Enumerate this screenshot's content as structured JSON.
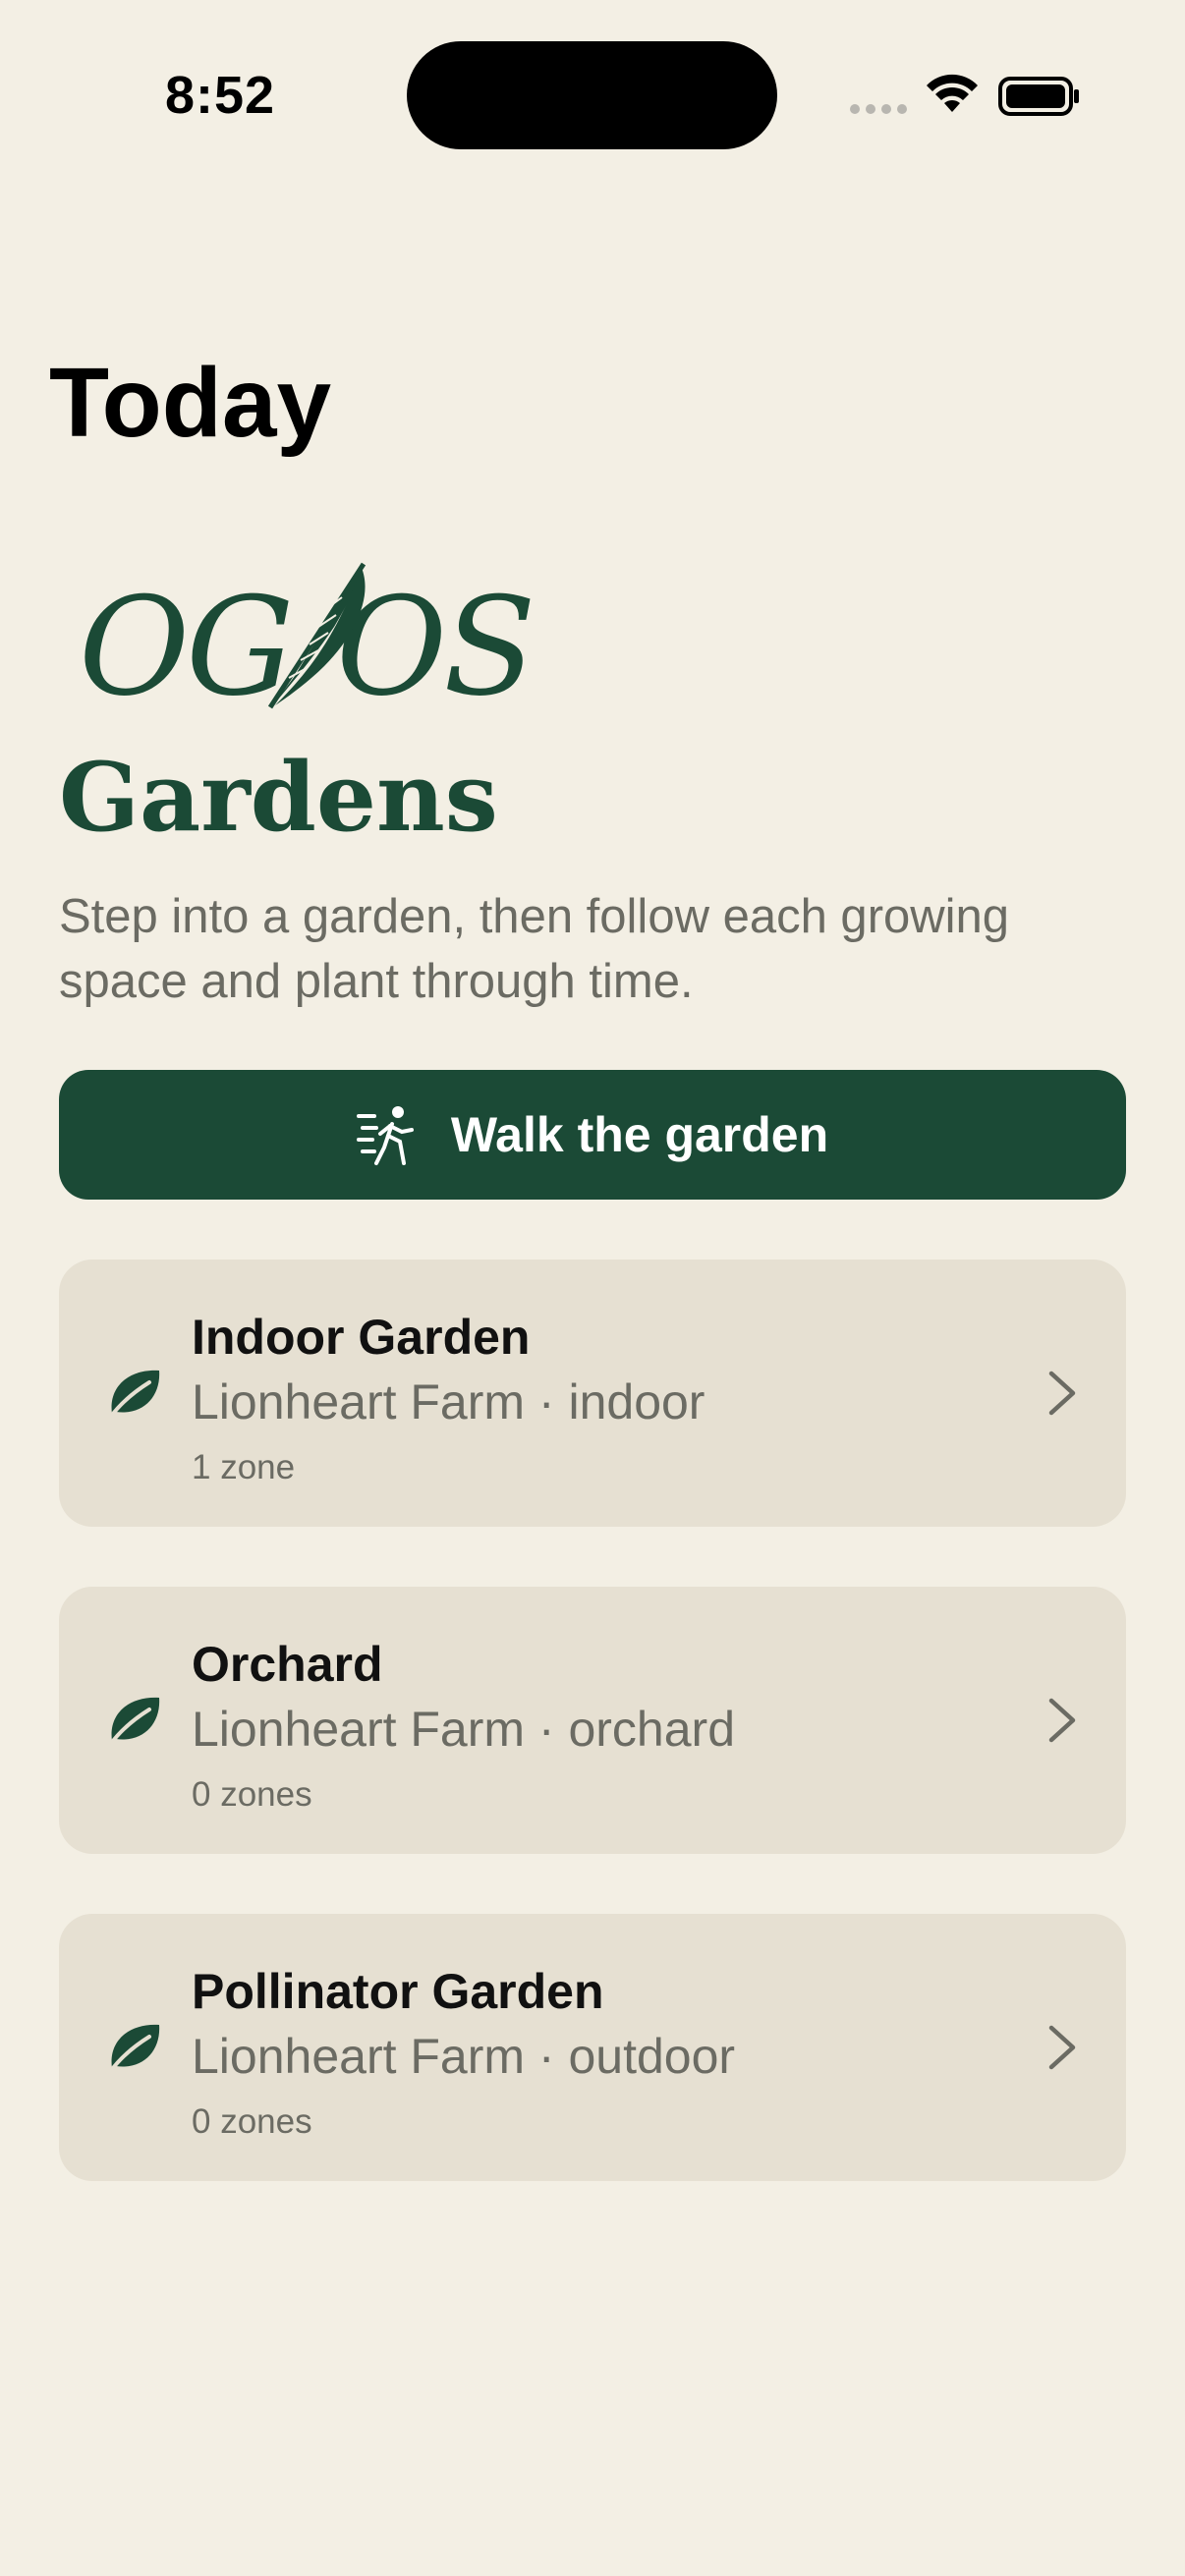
{
  "status_bar": {
    "time": "8:52"
  },
  "header": {
    "title": "Today"
  },
  "logo": {
    "text": "OG/OS",
    "brand_color": "#1b4a36"
  },
  "section": {
    "title": "Gardens",
    "subtitle": "Step into a garden, then follow each growing space and plant through time."
  },
  "walk_button": {
    "label": "Walk the garden",
    "icon": "walking-person-icon"
  },
  "gardens": [
    {
      "name": "Indoor Garden",
      "subtitle": "Lionheart Farm · indoor",
      "zones": "1 zone",
      "icon": "leaf-icon"
    },
    {
      "name": "Orchard",
      "subtitle": "Lionheart Farm · orchard",
      "zones": "0 zones",
      "icon": "leaf-icon"
    },
    {
      "name": "Pollinator Garden",
      "subtitle": "Lionheart Farm · outdoor",
      "zones": "0 zones",
      "icon": "leaf-icon"
    }
  ],
  "colors": {
    "background": "#f3efe4",
    "accent": "#1b4a36",
    "card": "#e6e0d2",
    "muted_text": "#6b6b63"
  }
}
